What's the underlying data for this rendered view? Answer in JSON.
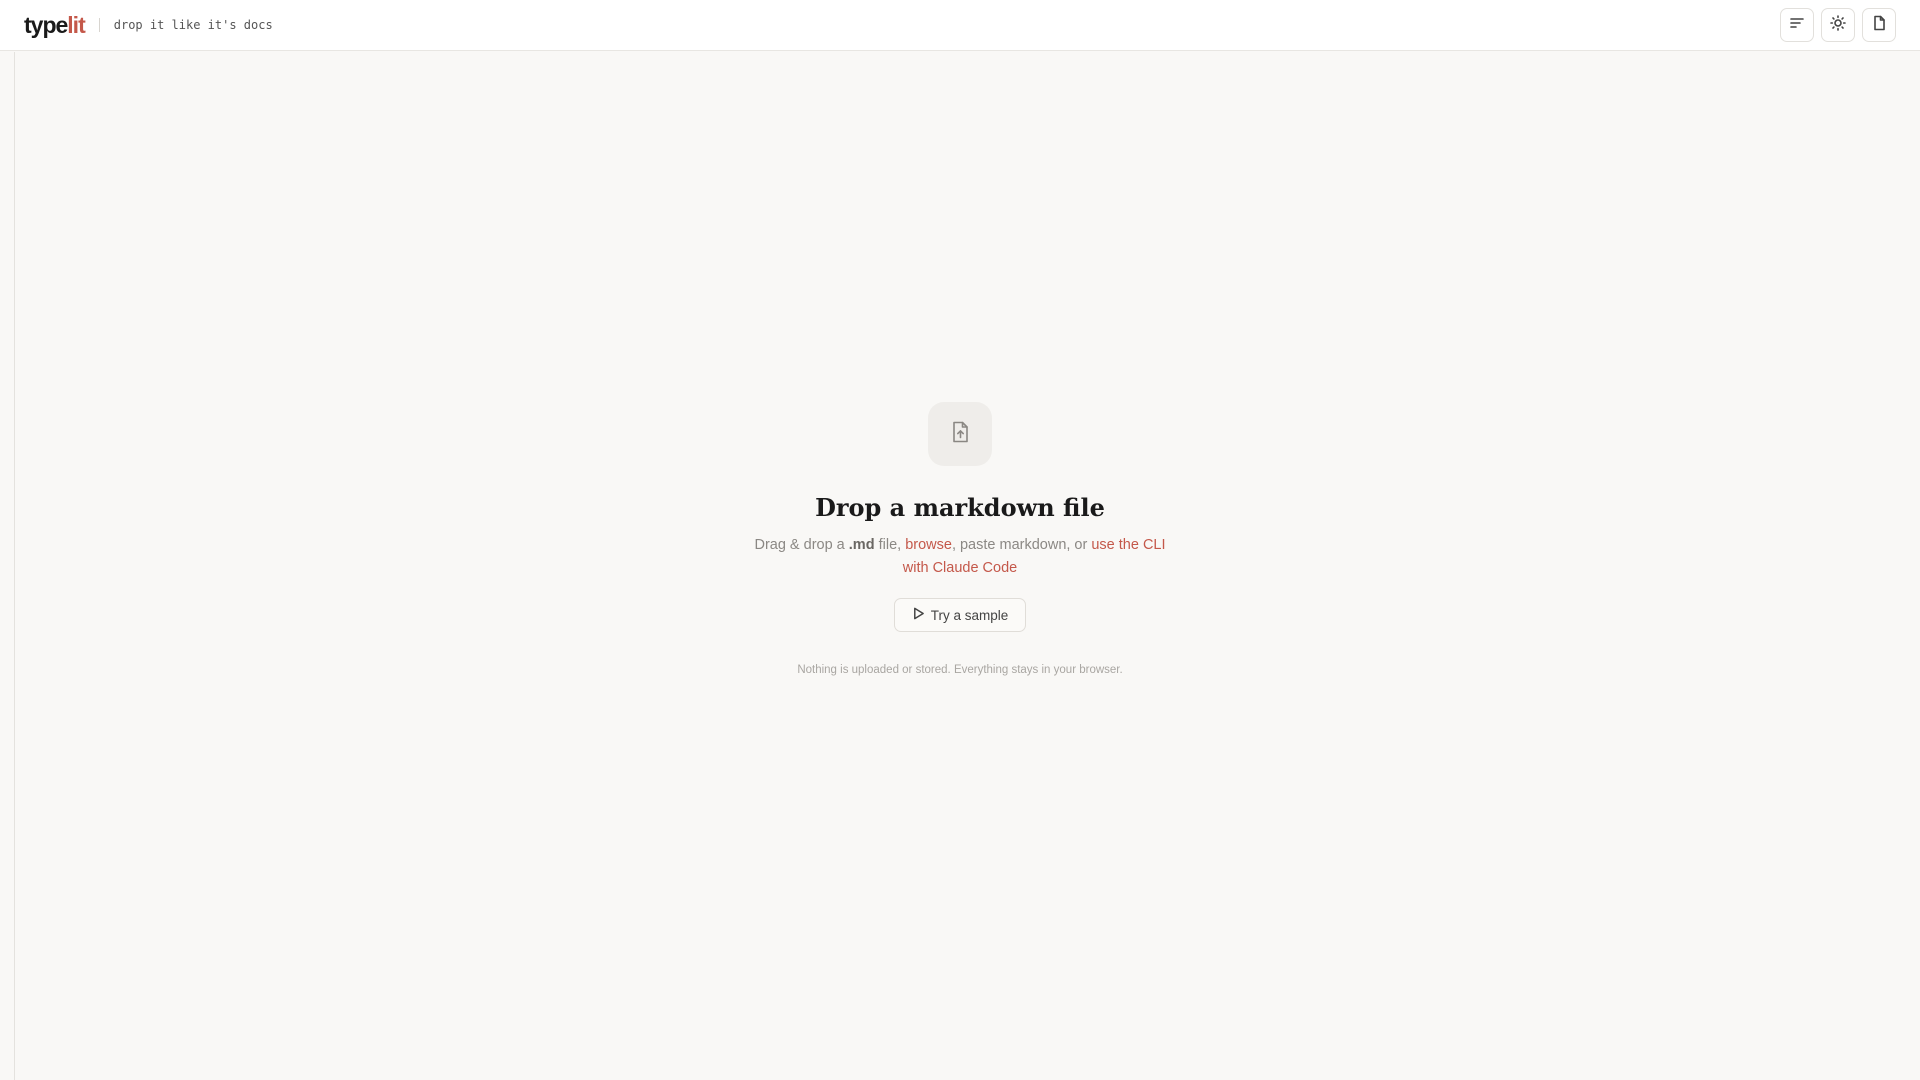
{
  "header": {
    "logo_main": "type",
    "logo_accent": "lit",
    "tagline": "drop it like it's docs",
    "actions": [
      {
        "name": "outline-button",
        "icon": "align-left-icon"
      },
      {
        "name": "theme-toggle-button",
        "icon": "sun-icon"
      },
      {
        "name": "document-button",
        "icon": "file-icon"
      }
    ]
  },
  "dropzone": {
    "icon": "file-upload-icon",
    "title": "Drop a markdown file",
    "subtitle_pre": "Drag & drop a ",
    "subtitle_ext": ".md",
    "subtitle_mid": " file, ",
    "browse_link": "browse",
    "subtitle_mid2": ", paste markdown, or ",
    "cli_link": "use the CLI with Claude Code",
    "sample_button": "Try a sample",
    "note": "Nothing is uploaded or stored. Everything stays in your browser."
  },
  "colors": {
    "accent": "#c4584a",
    "background": "#f9f8f6",
    "header_bg": "#ffffff"
  }
}
